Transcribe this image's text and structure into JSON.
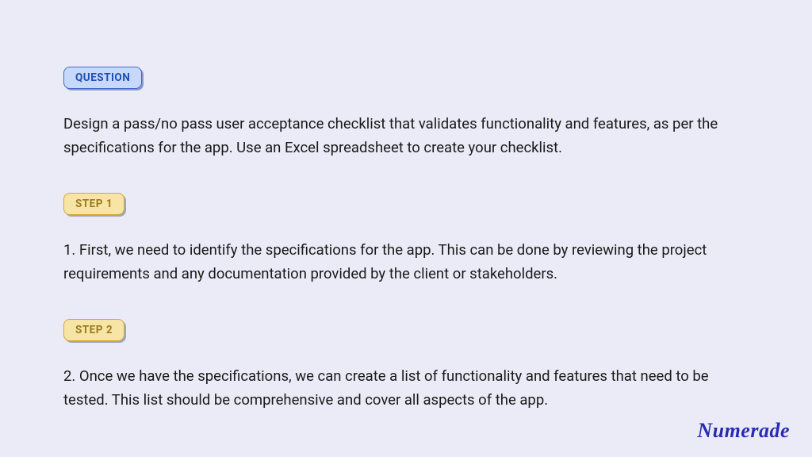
{
  "badges": {
    "question": "QUESTION",
    "step1": "STEP 1",
    "step2": "STEP 2"
  },
  "question_text": "Design a pass/no pass user acceptance checklist that validates functionality and features, as per the specifications for the app. Use an Excel spreadsheet to create your checklist.",
  "step1_text": "1. First, we need to identify the specifications for the app. This can be done by reviewing the project requirements and any documentation provided by the client or stakeholders.",
  "step2_text": "2. Once we have the specifications, we can create a list of functionality and features that need to be tested. This list should be comprehensive and cover all aspects of the app.",
  "logo_text": "Numerade"
}
